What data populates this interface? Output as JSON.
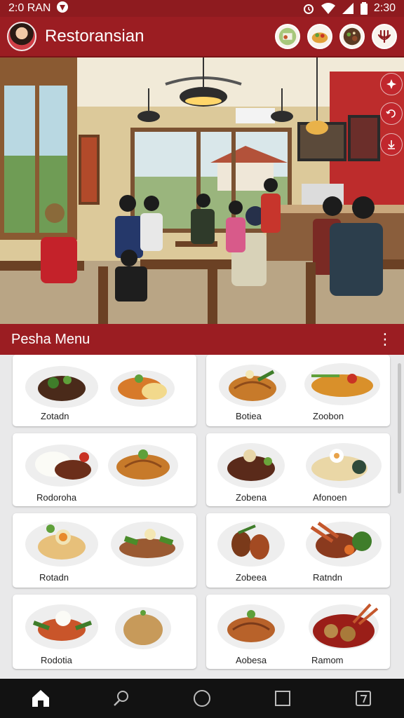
{
  "status": {
    "time": "2:0 RAN",
    "clock": "2:30"
  },
  "app": {
    "title": "Restoransian"
  },
  "menu": {
    "title": "Pesha Menu",
    "more": "⋮"
  },
  "dishes": [
    {
      "label_a": "Zotadn",
      "label_b": "Botiea",
      "label_c": "Zoobon"
    },
    {
      "label_a": "Rodoroha",
      "label_b": "Zobena",
      "label_c": "Afonoen"
    },
    {
      "label_a": "Rotadn",
      "label_b": "Zobeea",
      "label_c": "Ratndn"
    },
    {
      "label_a": "Rodotia",
      "label_b": "Aobesa",
      "label_c": "Ramom"
    }
  ],
  "colors": {
    "brand": "#9b1d22",
    "accent": "#c1272d"
  }
}
